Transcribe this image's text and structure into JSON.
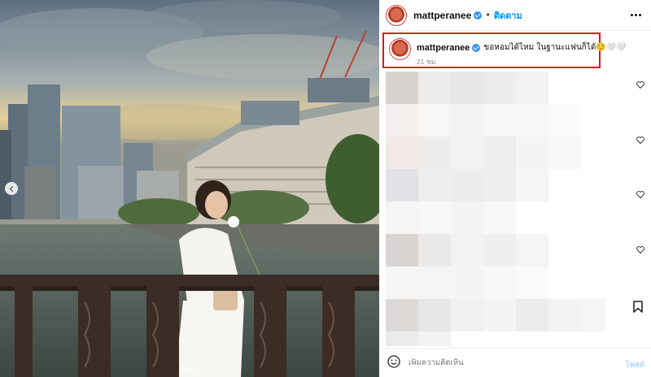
{
  "post": {
    "username": "mattperanee",
    "separator": "•",
    "follow_label": "ติดตาม",
    "verified_icon": "verified-badge-icon",
    "more_icon": "more-options-icon"
  },
  "caption": {
    "username": "mattperanee",
    "text": "ขอหอมได้ไหม ในฐานะแฟนก็ได้☺️🤍🤍",
    "timestamp": "21 ชม."
  },
  "carousel": {
    "prev_icon": "chevron-left-icon",
    "dot_count": 3,
    "active_dot": 0
  },
  "comments": {
    "like_icon": "heart-icon",
    "blurred": true
  },
  "actions": {
    "save_icon": "bookmark-icon",
    "emoji_icon": "emoji-icon"
  },
  "comment_box": {
    "placeholder": "เพิ่มความคิดเห็น",
    "post_label": "โพสต์"
  },
  "colors": {
    "accent": "#0095f6",
    "highlight_border": "#e0141e",
    "verified": "#3897f0"
  }
}
